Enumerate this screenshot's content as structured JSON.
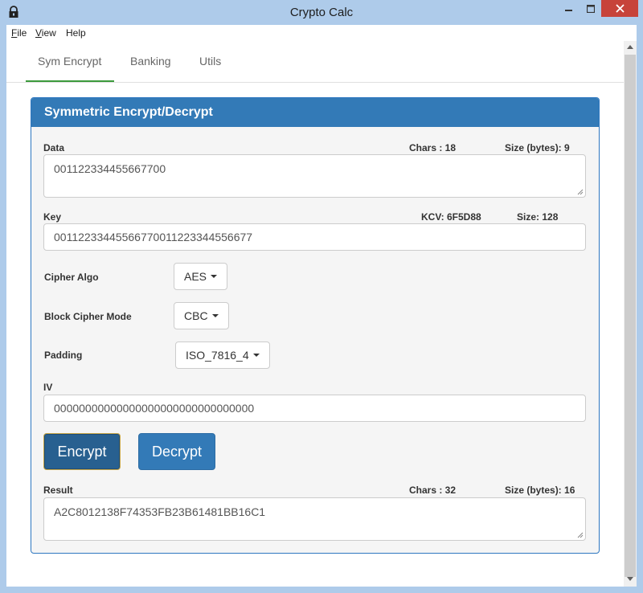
{
  "window": {
    "title": "Crypto Calc"
  },
  "menu": {
    "file": "File",
    "view": "View",
    "help": "Help"
  },
  "tabs": [
    {
      "label": "Sym Encrypt",
      "active": true
    },
    {
      "label": "Banking",
      "active": false
    },
    {
      "label": "Utils",
      "active": false
    }
  ],
  "panel": {
    "title": "Symmetric Encrypt/Decrypt"
  },
  "data_field": {
    "label": "Data",
    "chars": "Chars : 18",
    "size": "Size (bytes): 9",
    "value": "001122334455667700"
  },
  "key_field": {
    "label": "Key",
    "kcv": "KCV: 6F5D88",
    "size": "Size: 128",
    "value": "00112233445566770011223344556677"
  },
  "cipher_algo": {
    "label": "Cipher Algo",
    "value": "AES"
  },
  "block_mode": {
    "label": "Block Cipher Mode",
    "value": "CBC"
  },
  "padding": {
    "label": "Padding",
    "value": "ISO_7816_4"
  },
  "iv_field": {
    "label": "IV",
    "value": "00000000000000000000000000000000"
  },
  "buttons": {
    "encrypt": "Encrypt",
    "decrypt": "Decrypt"
  },
  "result_field": {
    "label": "Result",
    "chars": "Chars : 32",
    "size": "Size (bytes): 16",
    "value": "A2C8012138F74353FB23B61481BB16C1"
  },
  "colors": {
    "primary": "#337ab7",
    "primary_dark": "#286090",
    "tab_active": "#3c9a3c",
    "close_button": "#c7433a"
  }
}
